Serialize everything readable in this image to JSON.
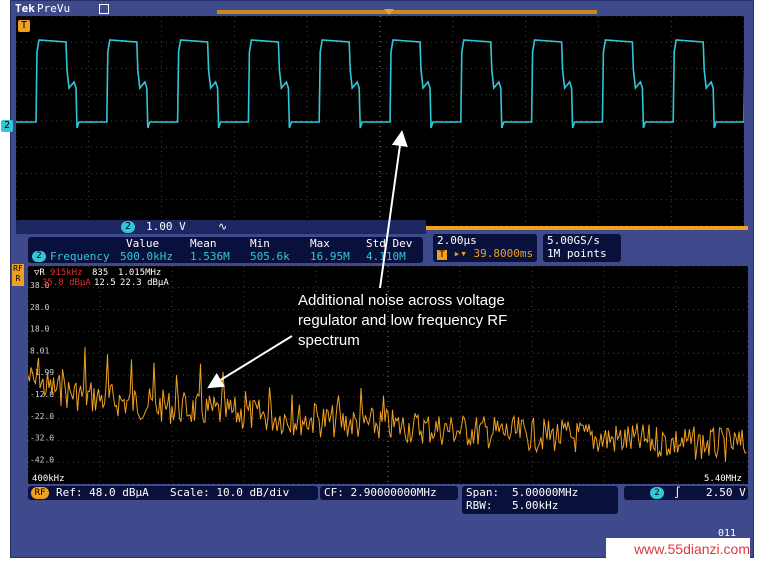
{
  "topbar": {
    "brand": "Tek",
    "mode": "PreVu"
  },
  "channel_label": "2",
  "trigger_label": "T",
  "scale_bar": {
    "channel": "2",
    "volts_div": "1.00 V",
    "bandwidth_icon": "∿"
  },
  "measurements": {
    "channel": "2",
    "headers": [
      "Value",
      "Mean",
      "Min",
      "Max",
      "Std Dev"
    ],
    "name": "Frequency",
    "values": [
      "500.0kHz",
      "1.536M",
      "505.6k",
      "16.95M",
      "4.110M"
    ]
  },
  "timebase": {
    "time_div": "2.00μs",
    "trigger_badge": "T",
    "position": "39.8000ms"
  },
  "sample": {
    "rate": "5.00GS/s",
    "points": "1M points"
  },
  "rf": {
    "marker_row1": [
      "915kHz",
      "835",
      "1.015MHz"
    ],
    "marker_row2": [
      "35.8 dBμA",
      "12.5",
      "22.3 dBμA"
    ],
    "y_ticks": [
      "38.0",
      "28.0",
      "18.0",
      "8.01",
      "-1.99",
      "-12.0",
      "-22.0",
      "-32.0",
      "-42.0"
    ],
    "x_start": "400kHz",
    "x_end": "5.40MHz"
  },
  "rf_settings": {
    "badge": "RF",
    "ref": "Ref: 48.0 dBμA",
    "scale": "Scale: 10.0 dB/div"
  },
  "cf": "CF: 2.90000000MHz",
  "span": {
    "span_label": "Span:",
    "span_value": "5.00000MHz",
    "rbw_label": "RBW:",
    "rbw_value": "5.00kHz"
  },
  "trigger": {
    "channel": "2",
    "slope": "∫",
    "level": "2.50 V"
  },
  "annotation": "Additional noise across voltage regulator and low frequency RF spectrum",
  "watermark": "www.55dianzi.com",
  "clock_fragment": "011",
  "colors": {
    "ch2": "#30c8d8",
    "rf": "#f0a020",
    "frame": "#3e4a8c"
  }
}
